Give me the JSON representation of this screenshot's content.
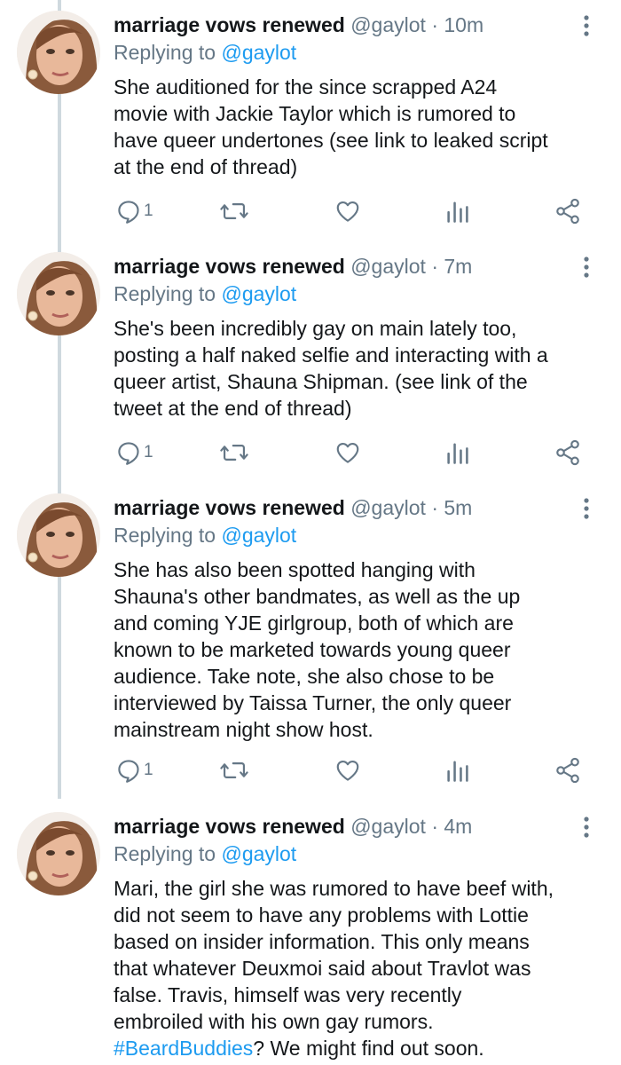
{
  "tweets": [
    {
      "display_name": "marriage vows renewed",
      "handle": "@gaylot",
      "separator": "·",
      "time": "10m",
      "replying_prefix": "Replying to",
      "replying_handle": "@gaylot",
      "text_lines": [
        "She auditioned for the since scrapped A24",
        "movie with Jackie Taylor which is rumored to",
        "have queer undertones (see link to leaked script",
        "at the end of thread)"
      ],
      "reply_count": "1"
    },
    {
      "display_name": "marriage vows renewed",
      "handle": "@gaylot",
      "separator": "·",
      "time": "7m",
      "replying_prefix": "Replying to",
      "replying_handle": "@gaylot",
      "text_lines": [
        "She's been incredibly gay on main lately too,",
        "posting a half naked selfie and interacting with a",
        "queer artist, Shauna Shipman. (see link of the",
        "tweet at the end of thread)"
      ],
      "reply_count": "1"
    },
    {
      "display_name": "marriage vows renewed",
      "handle": "@gaylot",
      "separator": "·",
      "time": "5m",
      "replying_prefix": "Replying to",
      "replying_handle": "@gaylot",
      "text_lines": [
        "She has also been spotted hanging with",
        "Shauna's other bandmates, as well as the up",
        "and coming YJE girlgroup, both of which are",
        "known to be marketed towards young queer",
        "audience. Take note, she also chose to be",
        "interviewed by Taissa Turner, the only queer",
        "mainstream night show host."
      ],
      "reply_count": "1"
    },
    {
      "display_name": "marriage vows renewed",
      "handle": "@gaylot",
      "separator": "·",
      "time": "4m",
      "replying_prefix": "Replying to",
      "replying_handle": "@gaylot",
      "text_lines": [
        "Mari, the girl she was rumored to have beef with,",
        "did not seem to have any problems with Lottie",
        "based on insider information. This only means",
        "that whatever Deuxmoi said about Travlot was",
        "false. Travis, himself was very recently",
        "embroiled with his own gay rumors."
      ],
      "hashtag": "#BeardBuddies",
      "text_after_hashtag": "? We might find out soon."
    }
  ],
  "icons": {
    "reply": "speech-bubble-icon",
    "retweet": "retweet-icon",
    "like": "heart-icon",
    "analytics": "bar-chart-icon",
    "share": "share-icon",
    "more": "vertical-dots-icon"
  },
  "colors": {
    "text": "#14171a",
    "secondary": "#657786",
    "link": "#1d9bf0",
    "thread_line": "#cfd9de"
  }
}
